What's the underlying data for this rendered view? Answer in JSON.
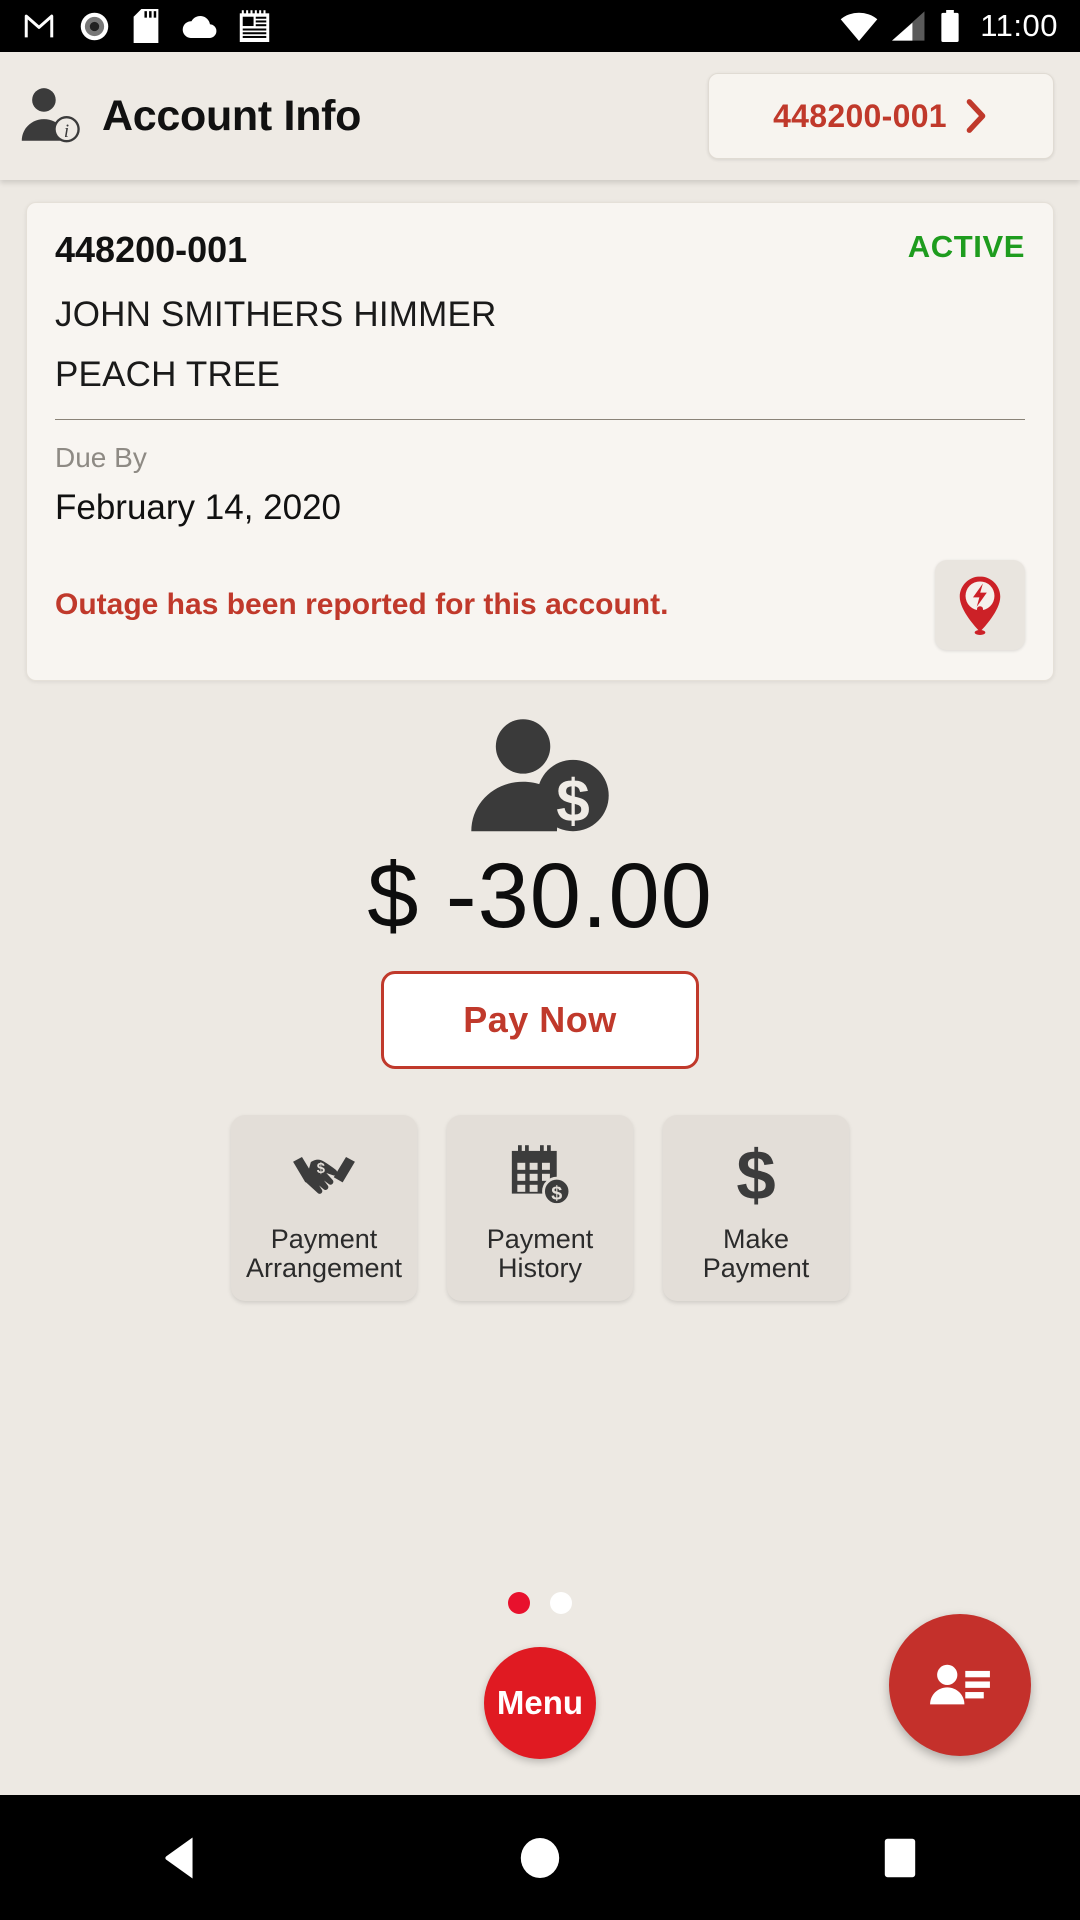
{
  "status_bar": {
    "icons_left": [
      "gmail-icon",
      "record-icon",
      "sd-card-icon",
      "cloud-icon",
      "news-icon"
    ],
    "icons_right": [
      "wifi-icon",
      "cellular-signal-icon",
      "battery-icon"
    ],
    "time": "11:00"
  },
  "header": {
    "title": "Account Info",
    "title_icon": "account-info-icon",
    "account_selector": {
      "label": "448200-001",
      "chevron": "chevron-right-icon"
    }
  },
  "account_card": {
    "account_number": "448200-001",
    "status": "ACTIVE",
    "status_color": "#1E9C1E",
    "customer_name": "JOHN SMITHERS HIMMER",
    "service_address": "PEACH TREE",
    "due_by_label": "Due By",
    "due_by_date": "February 14, 2020",
    "outage_message": "Outage has been reported for this account.",
    "outage_icon": "outage-pin-icon"
  },
  "balance": {
    "icon": "customer-balance-icon",
    "amount": "$ -30.00"
  },
  "pay_now": {
    "label": "Pay Now"
  },
  "quick_actions": [
    {
      "label": "Payment\nArrangement",
      "icon": "handshake-dollar-icon"
    },
    {
      "label": "Payment\nHistory",
      "icon": "calendar-dollar-icon"
    },
    {
      "label": "Make\nPayment",
      "icon": "dollar-sign-icon"
    }
  ],
  "pagination": {
    "total": 2,
    "active_index": 0,
    "active_color": "#E8112D",
    "inactive_color": "#FFFFFF"
  },
  "menu_button": {
    "label": "Menu",
    "color": "#E01A22"
  },
  "contact_fab": {
    "icon": "contact-card-icon",
    "color": "#C4302B"
  },
  "nav_bar": {
    "buttons": [
      "back-icon",
      "home-icon",
      "recents-icon"
    ]
  },
  "theme": {
    "page_background": "#EDE9E3",
    "card_background": "#F8F5F1",
    "accent_red": "#C0392B",
    "tile_background": "#E3DED8"
  }
}
